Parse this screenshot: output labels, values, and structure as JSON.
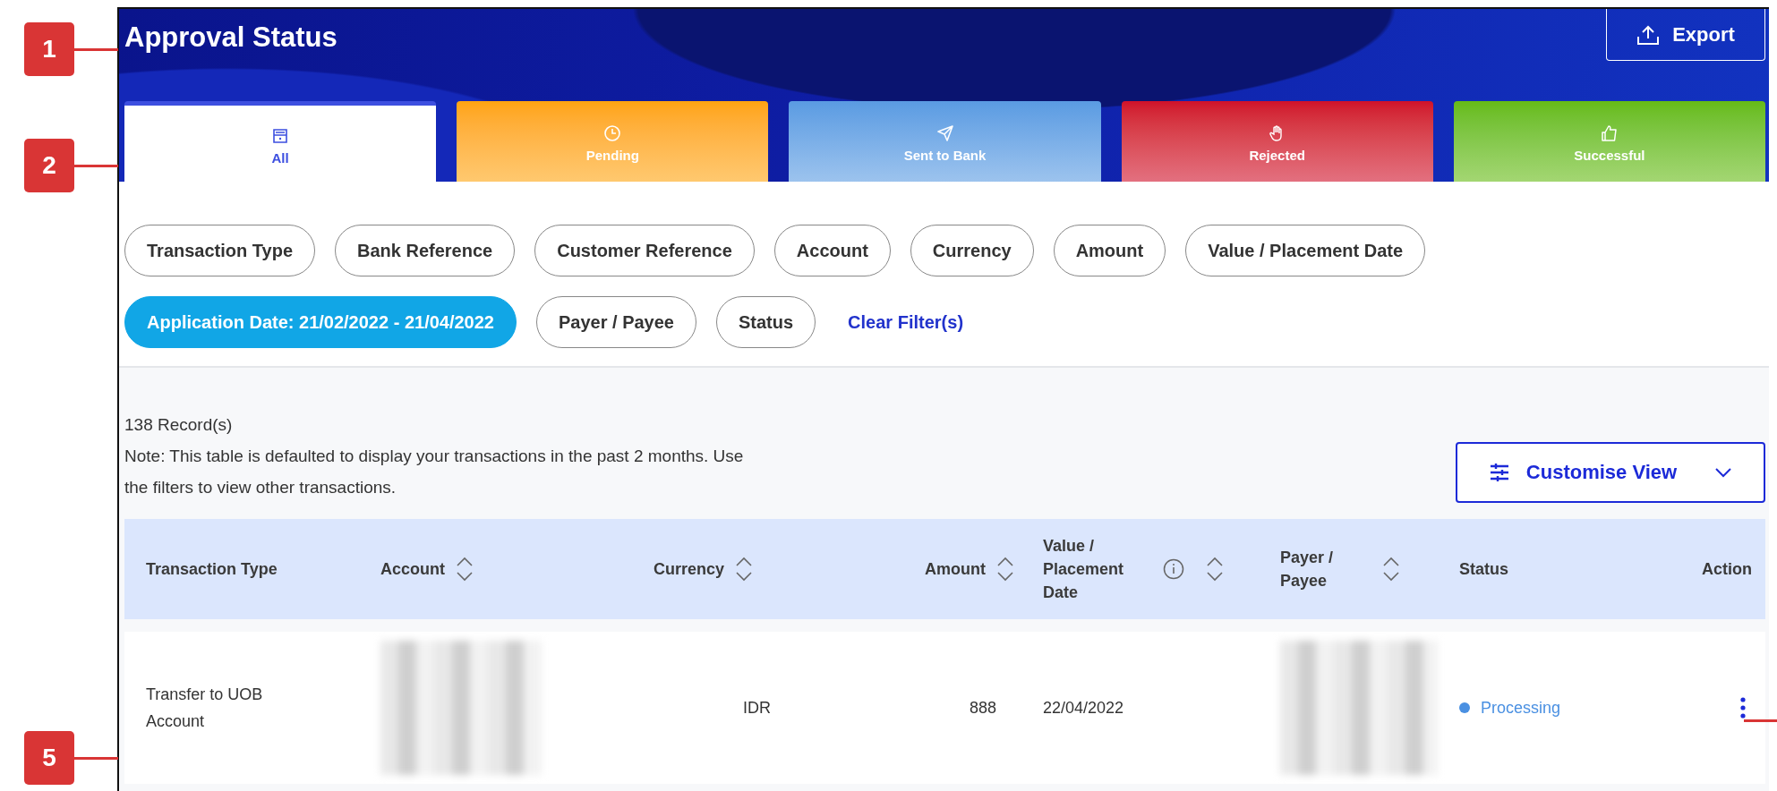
{
  "annotations": [
    {
      "label": "1",
      "kind": "title"
    },
    {
      "label": "2",
      "kind": "tabs"
    },
    {
      "label": "5",
      "kind": "row"
    }
  ],
  "header": {
    "title": "Approval Status",
    "export_button": "Export"
  },
  "tabs": [
    {
      "label": "All",
      "kind": "all",
      "color": "#ffffff",
      "selected": true
    },
    {
      "label": "Pending",
      "kind": "pending",
      "color": "#ffa40e",
      "selected": false
    },
    {
      "label": "Sent to Bank",
      "kind": "sent",
      "color": "#5a9be2",
      "selected": false
    },
    {
      "label": "Rejected",
      "kind": "rejected",
      "color": "#d0102a",
      "selected": false
    },
    {
      "label": "Successful",
      "kind": "successful",
      "color": "#66bb14",
      "selected": false
    }
  ],
  "filters": [
    {
      "label": "Transaction Type",
      "active": false
    },
    {
      "label": "Bank Reference",
      "active": false
    },
    {
      "label": "Customer Reference",
      "active": false
    },
    {
      "label": "Account",
      "active": false
    },
    {
      "label": "Currency",
      "active": false
    },
    {
      "label": "Amount",
      "active": false
    },
    {
      "label": "Value / Placement Date",
      "active": false
    },
    {
      "label": "Application Date: 21/02/2022 - 21/04/2022",
      "active": true
    },
    {
      "label": "Payer / Payee",
      "active": false
    },
    {
      "label": "Status",
      "active": false
    }
  ],
  "clear_filters": "Clear Filter(s)",
  "record_count": "138 Record(s)",
  "note": "Note: This table is defaulted to display your transactions in the past 2 months. Use the filters to view other transactions.",
  "customise_view_button": "Customise View",
  "table": {
    "columns": [
      {
        "label": "Transaction Type",
        "sortable": false,
        "info": false
      },
      {
        "label": "Account",
        "sortable": true,
        "info": false
      },
      {
        "label": "Currency",
        "sortable": true,
        "info": false
      },
      {
        "label": "Amount",
        "sortable": true,
        "info": false
      },
      {
        "label": "Value / Placement Date",
        "sortable": true,
        "info": true
      },
      {
        "label": "Payer / Payee",
        "sortable": true,
        "info": false
      },
      {
        "label": "Status",
        "sortable": false,
        "info": false
      },
      {
        "label": "Action",
        "sortable": false,
        "info": false
      }
    ],
    "rows": [
      {
        "transaction_type": "Transfer to UOB Account",
        "account_redacted": true,
        "currency": "IDR",
        "amount": "888",
        "value_date": "22/04/2022",
        "payer_redacted": true,
        "status": "Processing",
        "color": "#4a90e2"
      }
    ]
  }
}
